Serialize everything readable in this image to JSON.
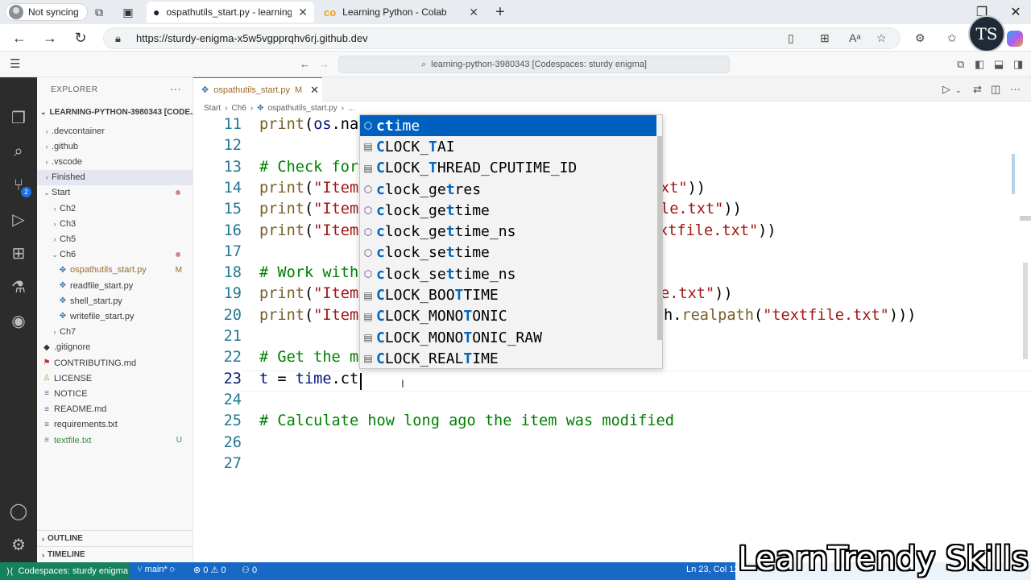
{
  "browser": {
    "profile_label": "Not syncing",
    "tabs": [
      {
        "title": "ospathutils_start.py - learning-pyt",
        "icon": "github-icon"
      },
      {
        "title": "Learning Python - Colab",
        "icon": "colab-icon"
      }
    ],
    "new_tab": "+",
    "url": "https://sturdy-enigma-x5w5vgpprqhv6rj.github.dev",
    "avatar_text": "TS"
  },
  "vscode": {
    "command_center": "learning-python-3980343 [Codespaces: sturdy enigma]",
    "sidebar": {
      "header": "EXPLORER",
      "more": "···",
      "root": "LEARNING-PYTHON-3980343 [CODE...",
      "items": [
        {
          "label": ".devcontainer",
          "kind": "folder",
          "depth": 1,
          "chev": "›"
        },
        {
          "label": ".github",
          "kind": "folder",
          "depth": 1,
          "chev": "›"
        },
        {
          "label": ".vscode",
          "kind": "folder",
          "depth": 1,
          "chev": "›"
        },
        {
          "label": "Finished",
          "kind": "folder",
          "depth": 1,
          "chev": "›"
        },
        {
          "label": "Start",
          "kind": "folder",
          "depth": 1,
          "chev": "⌄"
        },
        {
          "label": "Ch2",
          "kind": "folder",
          "depth": 2,
          "chev": "›"
        },
        {
          "label": "Ch3",
          "kind": "folder",
          "depth": 2,
          "chev": "›"
        },
        {
          "label": "Ch5",
          "kind": "folder",
          "depth": 2,
          "chev": "›"
        },
        {
          "label": "Ch6",
          "kind": "folder",
          "depth": 2,
          "chev": "⌄"
        },
        {
          "label": "ospathutils_start.py",
          "kind": "py",
          "depth": 3,
          "mod": "M"
        },
        {
          "label": "readfile_start.py",
          "kind": "py",
          "depth": 3
        },
        {
          "label": "shell_start.py",
          "kind": "py",
          "depth": 3
        },
        {
          "label": "writefile_start.py",
          "kind": "py",
          "depth": 3
        },
        {
          "label": "Ch7",
          "kind": "folder",
          "depth": 2,
          "chev": "›"
        },
        {
          "label": ".gitignore",
          "kind": "git",
          "depth": 1
        },
        {
          "label": "CONTRIBUTING.md",
          "kind": "md",
          "depth": 1
        },
        {
          "label": "LICENSE",
          "kind": "lic",
          "depth": 1
        },
        {
          "label": "NOTICE",
          "kind": "txt",
          "depth": 1
        },
        {
          "label": "README.md",
          "kind": "txt",
          "depth": 1
        },
        {
          "label": "requirements.txt",
          "kind": "txt",
          "depth": 1
        },
        {
          "label": "textfile.txt",
          "kind": "txt",
          "depth": 1,
          "mod": "U"
        }
      ],
      "outline": "OUTLINE",
      "timeline": "TIMELINE"
    },
    "editor": {
      "tab_label": "ospathutils_start.py",
      "tab_mod": "M",
      "breadcrumb": [
        "Start",
        "Ch6",
        "ospathutils_start.py",
        "..."
      ],
      "lines": [
        {
          "n": "11",
          "html": "<span class='fn'>print</span>(<span class='var'>os</span>.na"
        },
        {
          "n": "12",
          "html": ""
        },
        {
          "n": "13",
          "html": "<span class='cmt'># Check for</span>"
        },
        {
          "n": "14",
          "html": "<span class='fn'>print</span>(<span class='str'>\"Item</span>"
        },
        {
          "n": "15",
          "html": "<span class='fn'>print</span>(<span class='str'>\"Item</span>"
        },
        {
          "n": "16",
          "html": "<span class='fn'>print</span>(<span class='str'>\"Item</span>"
        },
        {
          "n": "17",
          "html": ""
        },
        {
          "n": "18",
          "html": "<span class='cmt'># Work with</span>"
        },
        {
          "n": "19",
          "html": "<span class='fn'>print</span>(<span class='str'>\"Item</span>"
        },
        {
          "n": "20",
          "html": "<span class='fn'>print</span>(<span class='str'>\"Item</span>"
        },
        {
          "n": "21",
          "html": ""
        },
        {
          "n": "22",
          "html": "<span class='cmt'># Get the m</span>"
        },
        {
          "n": "23",
          "html": "<span class='var'>t</span> = <span class='var'>time</span>.ct"
        },
        {
          "n": "24",
          "html": ""
        },
        {
          "n": "25",
          "html": "<span class='cmt'># Calculate how long ago the item was modified</span>"
        },
        {
          "n": "26",
          "html": ""
        },
        {
          "n": "27",
          "html": ""
        }
      ],
      "tails": [
        {
          "line": "14",
          "html": "<span class='str'>xt\"</span>))"
        },
        {
          "line": "15",
          "html": "<span class='str'>le.txt\"</span>))"
        },
        {
          "line": "16",
          "html": "<span class='str'>xtfile.txt\"</span>))"
        },
        {
          "line": "19",
          "html": "<span class='str'>e.txt\"</span>))"
        },
        {
          "line": "20",
          "html": "h.<span class='fn'>realpath</span>(<span class='str'>\"textfile.txt\"</span>)))"
        }
      ]
    },
    "suggest": [
      {
        "pre": "",
        "match": "ct",
        "post": "ime",
        "kind": "method",
        "selected": true,
        "label": "ctime"
      },
      {
        "pre": "",
        "match": "C",
        "post": "LOCK_",
        "match2": "T",
        "post2": "AI",
        "kind": "field",
        "label": "CLOCK_TAI"
      },
      {
        "pre": "",
        "match": "C",
        "post": "LOCK_",
        "match2": "T",
        "post2": "HREAD_CPUTIME_ID",
        "kind": "field",
        "label": "CLOCK_THREAD_CPUTIME_ID"
      },
      {
        "pre": "",
        "match": "c",
        "post": "lock_ge",
        "match2": "t",
        "post2": "res",
        "kind": "method",
        "label": "clock_getres"
      },
      {
        "pre": "",
        "match": "c",
        "post": "lock_ge",
        "match2": "t",
        "post2": "time",
        "kind": "method",
        "label": "clock_gettime"
      },
      {
        "pre": "",
        "match": "c",
        "post": "lock_ge",
        "match2": "t",
        "post2": "time_ns",
        "kind": "method",
        "label": "clock_gettime_ns"
      },
      {
        "pre": "",
        "match": "c",
        "post": "lock_se",
        "match2": "t",
        "post2": "time",
        "kind": "method",
        "label": "clock_settime"
      },
      {
        "pre": "",
        "match": "c",
        "post": "lock_se",
        "match2": "t",
        "post2": "time_ns",
        "kind": "method",
        "label": "clock_settime_ns"
      },
      {
        "pre": "",
        "match": "C",
        "post": "LOCK_BOO",
        "match2": "T",
        "post2": "TIME",
        "kind": "field",
        "label": "CLOCK_BOOTTIME"
      },
      {
        "pre": "",
        "match": "C",
        "post": "LOCK_MONO",
        "match2": "T",
        "post2": "ONIC",
        "kind": "field",
        "label": "CLOCK_MONOTONIC"
      },
      {
        "pre": "",
        "match": "C",
        "post": "LOCK_MONO",
        "match2": "T",
        "post2": "ONIC_RAW",
        "kind": "field",
        "label": "CLOCK_MONOTONIC_RAW"
      },
      {
        "pre": "",
        "match": "C",
        "post": "LOCK_REAL",
        "match2": "T",
        "post2": "IME",
        "kind": "field",
        "label": "CLOCK_REALTIME"
      }
    ],
    "status": {
      "remote": "Codespaces: sturdy enigma",
      "branch": "main*",
      "problems": "⊗ 0 ⚠ 0",
      "ports": "0",
      "cursor": "Ln 23, Col 12"
    },
    "scm_badge": "2"
  },
  "watermark": "LearnTrendy Skills",
  "colors": {
    "accent": "#1769c5",
    "remote": "#16825d",
    "selection": "#0060c0"
  }
}
